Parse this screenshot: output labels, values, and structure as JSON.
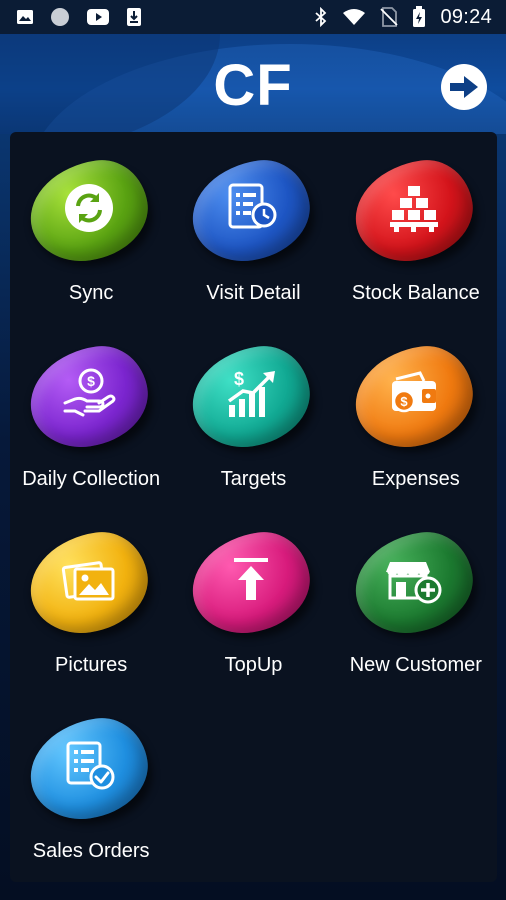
{
  "status_bar": {
    "time": "09:24",
    "left_icons": [
      "image-icon",
      "circle-icon",
      "youtube-icon",
      "download-icon"
    ],
    "right_icons": [
      "bluetooth-icon",
      "wifi-icon",
      "no-sim-icon",
      "battery-icon"
    ]
  },
  "header": {
    "title": "CF",
    "action_icon": "logout-arrow-icon"
  },
  "menu": {
    "items": [
      {
        "label": "Sync",
        "icon": "sync-icon",
        "color": "#5aa312"
      },
      {
        "label": "Visit Detail",
        "icon": "visit-detail-icon",
        "color": "#1e56c4"
      },
      {
        "label": "Stock Balance",
        "icon": "stock-balance-icon",
        "color": "#d4141b"
      },
      {
        "label": "Daily Collection",
        "icon": "daily-collection-icon",
        "color": "#7b25cf"
      },
      {
        "label": "Targets",
        "icon": "targets-icon",
        "color": "#11a993"
      },
      {
        "label": "Expenses",
        "icon": "expenses-icon",
        "color": "#f07a10"
      },
      {
        "label": "Pictures",
        "icon": "pictures-icon",
        "color": "#f2b20f"
      },
      {
        "label": "TopUp",
        "icon": "topup-icon",
        "color": "#d81b7c"
      },
      {
        "label": "New Customer",
        "icon": "new-customer-icon",
        "color": "#1c7a30"
      },
      {
        "label": "Sales Orders",
        "icon": "sales-orders-icon",
        "color": "#1f8fe0"
      }
    ]
  },
  "colors": {
    "header_bg": "#0e4c9e",
    "panel_bg": "#0a1220",
    "status_bar_bg": "#0b1c35"
  }
}
